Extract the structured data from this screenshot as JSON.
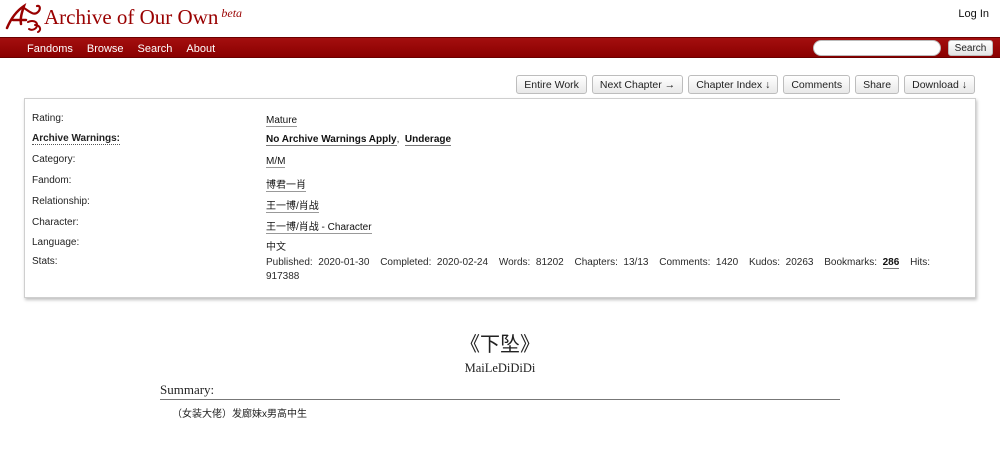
{
  "header": {
    "site_title": "Archive of Our Own",
    "site_beta": "beta",
    "login": "Log In",
    "logo_icon": "ao3-logo-icon",
    "brand_color": "#990000"
  },
  "nav": {
    "items": [
      "Fandoms",
      "Browse",
      "Search",
      "About"
    ],
    "search_placeholder": "",
    "search_button": "Search"
  },
  "work_nav": {
    "buttons": [
      "Entire Work",
      "Next Chapter →",
      "Chapter Index ↓",
      "Comments",
      "Share",
      "Download ↓"
    ]
  },
  "meta": {
    "rating": {
      "label": "Rating:",
      "value": "Mature"
    },
    "warnings": {
      "label": "Archive Warnings:",
      "values": [
        "No Archive Warnings Apply",
        "Underage"
      ]
    },
    "category": {
      "label": "Category:",
      "value": "M/M"
    },
    "fandom": {
      "label": "Fandom:",
      "value": "博君一肖"
    },
    "relationship": {
      "label": "Relationship:",
      "value": "王一博/肖战"
    },
    "character": {
      "label": "Character:",
      "value": "王一博/肖战 - Character"
    },
    "language": {
      "label": "Language:",
      "value": "中文"
    },
    "stats": {
      "label": "Stats:",
      "published_label": "Published:",
      "published": "2020-01-30",
      "completed_label": "Completed:",
      "completed": "2020-02-24",
      "words_label": "Words:",
      "words": "81202",
      "chapters_label": "Chapters:",
      "chapters": "13/13",
      "comments_label": "Comments:",
      "comments": "1420",
      "kudos_label": "Kudos:",
      "kudos": "20263",
      "bookmarks_label": "Bookmarks:",
      "bookmarks": "286",
      "hits_label": "Hits:",
      "hits": "917388"
    }
  },
  "work": {
    "title": "《下坠》",
    "author": "MaiLeDiDiDi",
    "summary_heading": "Summary:",
    "summary": "（女装大佬）发廊妹x男高中生"
  }
}
